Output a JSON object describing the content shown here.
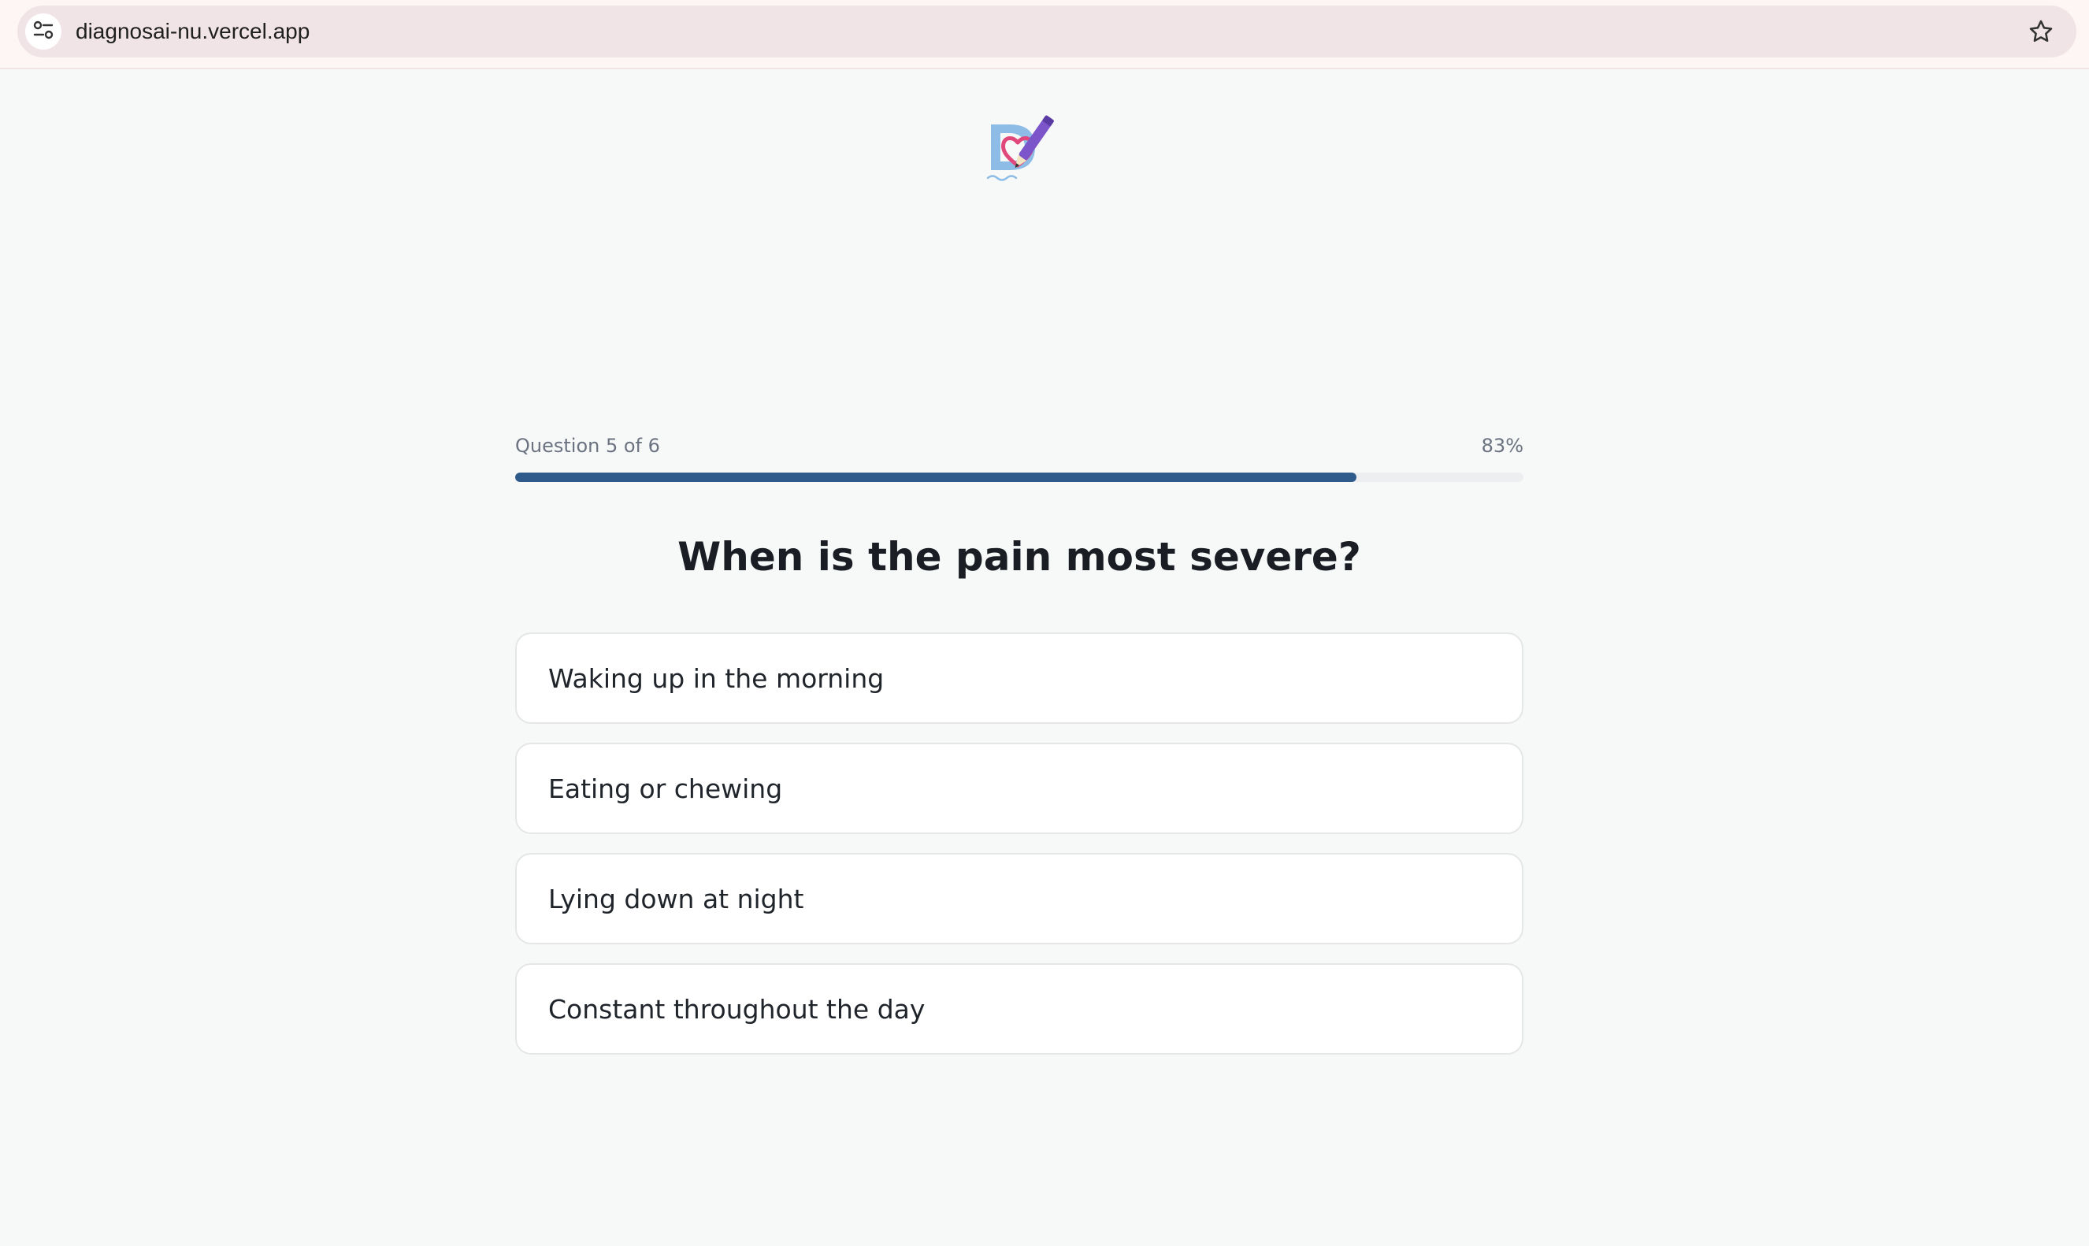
{
  "browser": {
    "url": "diagnosai-nu.vercel.app",
    "site_info_icon": "tune-icon",
    "bookmark_icon": "star-icon"
  },
  "logo": {
    "icon": "diagnosai-logo",
    "colors": {
      "letter": "#8dbde6",
      "heart": "#e0487c",
      "pen": "#7b55c9"
    }
  },
  "progress": {
    "label": "Question 5 of 6",
    "percent_label": "83%",
    "fraction": 0.834,
    "fill_color": "#2f5a8c"
  },
  "question": {
    "title": "When is the pain most severe?"
  },
  "options": [
    {
      "label": "Waking up in the morning"
    },
    {
      "label": "Eating or chewing"
    },
    {
      "label": "Lying down at night"
    },
    {
      "label": "Constant throughout the day"
    }
  ]
}
